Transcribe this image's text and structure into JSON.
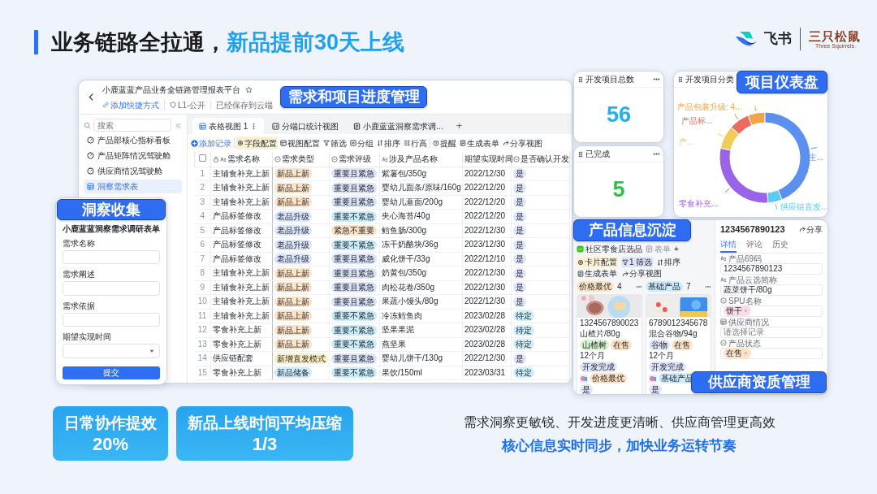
{
  "slide": {
    "title": "业务链路全拉通，",
    "title_highlight": "新品提前30天上线"
  },
  "logo": {
    "product": "飞书",
    "partner": "三只松鼠",
    "partner_en": "Three Squirrels"
  },
  "callouts": [
    "需求和项目进度管理",
    "洞察收集",
    "项目仪表盘",
    "产品信息沉淀",
    "供应商资质管理"
  ],
  "base_window": {
    "title": "小鹿蓝蓝产品业务全链路管理报表平台",
    "shortcut": "添加快捷方式",
    "visibility": "L1-公开",
    "save_status": "已经保存到云端",
    "search": {
      "placeholder": "搜索"
    },
    "sidebar": [
      {
        "label": "产品部核心指标看板",
        "selected": false
      },
      {
        "label": "产品矩阵情况驾驶舱",
        "selected": false
      },
      {
        "label": "供应商情况驾驶舱",
        "selected": false
      },
      {
        "label": "洞察需求表",
        "selected": true
      }
    ],
    "tabs": [
      {
        "label": "表格视图 1",
        "selected": true
      },
      {
        "label": "分端口统计视图",
        "selected": false
      },
      {
        "label": "小鹿蓝蓝洞察需求调...",
        "selected": false
      }
    ],
    "new_tab": "+",
    "add_record": "添加记录",
    "toolbar": [
      {
        "label": "字段配置",
        "active": true
      },
      {
        "label": "视图配置",
        "active": false
      },
      {
        "label": "筛选",
        "active": false
      },
      {
        "label": "分组",
        "active": false
      },
      {
        "label": "排序",
        "active": false
      },
      {
        "label": "行高",
        "active": false
      },
      {
        "label": "提醒",
        "active": false
      },
      {
        "label": "生成表单",
        "active": false
      },
      {
        "label": "分享视图",
        "active": false
      }
    ],
    "table": {
      "columns": [
        {
          "kind": "checkbox",
          "checked": false
        },
        {
          "label": "需求名称",
          "kind": "text",
          "locked": true
        },
        {
          "label": "需求类型",
          "kind": "select",
          "locked": false
        },
        {
          "label": "需求评级",
          "kind": "select",
          "locked": false
        },
        {
          "label": "涉及产品名称",
          "kind": "text",
          "locked": false
        },
        {
          "label": "期望实现时间",
          "kind": "date",
          "locked": false
        },
        {
          "label": "是否确认开发",
          "kind": "select",
          "locked": false
        }
      ],
      "rows": [
        [
          "1",
          "主辅食补充上新",
          {
            "text": "新品上新",
            "color": "#fde3c6"
          },
          {
            "text": "重要且紧急",
            "color": "#dbe3f8"
          },
          "紫薯包/350g",
          "2022/12/30",
          {
            "text": "是",
            "color": "#dfe6fb"
          }
        ],
        [
          "2",
          "主辅食补充上新",
          {
            "text": "新品上新",
            "color": "#fde3c6"
          },
          {
            "text": "重要且紧急",
            "color": "#dbe3f8"
          },
          "婴幼儿面条/原味/160g",
          "2022/12/20",
          {
            "text": "是",
            "color": "#dfe6fb"
          }
        ],
        [
          "3",
          "主辅食补充上新",
          {
            "text": "新品上新",
            "color": "#fde3c6"
          },
          {
            "text": "重要且紧急",
            "color": "#dbe3f8"
          },
          "婴幼儿薏面/200g",
          "2022/12/20",
          {
            "text": "是",
            "color": "#dfe6fb"
          }
        ],
        [
          "4",
          "产品标签修改",
          {
            "text": "老品升级",
            "color": "#dbe5fb"
          },
          {
            "text": "重要不紧急",
            "color": "#c9ecfa"
          },
          "夹心海苔/40g",
          "2022/12/20",
          {
            "text": "是",
            "color": "#dfe6fb"
          }
        ],
        [
          "5",
          "产品标签修改",
          {
            "text": "老品升级",
            "color": "#dbe5fb"
          },
          {
            "text": "紧急不重要",
            "color": "#fde3c6"
          },
          "鳕鱼肠/300g",
          "2022/12/30",
          {
            "text": "是",
            "color": "#dfe6fb"
          }
        ],
        [
          "6",
          "产品标签修改",
          {
            "text": "老品升级",
            "color": "#dbe5fb"
          },
          {
            "text": "重要不紧急",
            "color": "#c9ecfa"
          },
          "冻干奶酪块/36g",
          "2023/12/30",
          {
            "text": "是",
            "color": "#dfe6fb"
          }
        ],
        [
          "7",
          "产品标签修改",
          {
            "text": "老品升级",
            "color": "#dbe5fb"
          },
          {
            "text": "重要且紧急",
            "color": "#dbe3f8"
          },
          "威化饼干/33g",
          "2022/12/10",
          {
            "text": "是",
            "color": "#dfe6fb"
          }
        ],
        [
          "8",
          "主辅食补充上新",
          {
            "text": "新品上新",
            "color": "#fde3c6"
          },
          {
            "text": "重要且紧急",
            "color": "#dbe3f8"
          },
          "奶黄包/350g",
          "2022/12/30",
          {
            "text": "是",
            "color": "#dfe6fb"
          }
        ],
        [
          "9",
          "主辅食补充上新",
          {
            "text": "新品上新",
            "color": "#fde3c6"
          },
          {
            "text": "重要且紧急",
            "color": "#dbe3f8"
          },
          "肉松花卷/350g",
          "2022/12/30",
          {
            "text": "是",
            "color": "#dfe6fb"
          }
        ],
        [
          "10",
          "主辅食补充上新",
          {
            "text": "新品上新",
            "color": "#fde3c6"
          },
          {
            "text": "重要且紧急",
            "color": "#dbe3f8"
          },
          "果蔬小馒头/80g",
          "2022/12/30",
          {
            "text": "是",
            "color": "#dfe6fb"
          }
        ],
        [
          "11",
          "主辅食补充上新",
          {
            "text": "新品上新",
            "color": "#fde3c6"
          },
          {
            "text": "重要不紧急",
            "color": "#c9ecfa"
          },
          "冷冻鳕鱼肉",
          "2023/02/28",
          {
            "text": "待定",
            "color": "#cdeefa"
          }
        ],
        [
          "12",
          "零食补充上新",
          {
            "text": "新品上新",
            "color": "#fde3c6"
          },
          {
            "text": "重要不紧急",
            "color": "#c9ecfa"
          },
          "坚果果泥",
          "2023/02/28",
          {
            "text": "待定",
            "color": "#cdeefa"
          }
        ],
        [
          "13",
          "零食补充上新",
          {
            "text": "新品上新",
            "color": "#fde3c6"
          },
          {
            "text": "重要不紧急",
            "color": "#c9ecfa"
          },
          "燕坚果",
          "2023/02/28",
          {
            "text": "待定",
            "color": "#cdeefa"
          }
        ],
        [
          "14",
          "供应链配套",
          {
            "text": "新增直发模式",
            "color": "#fcefc2"
          },
          {
            "text": "重要且紧急",
            "color": "#dbe3f8"
          },
          "婴幼儿饼干/130g",
          "2022/12/30",
          {
            "text": "是",
            "color": "#dfe6fb"
          }
        ],
        [
          "15",
          "零食补充上新",
          {
            "text": "新品储备",
            "color": "#cdebfa"
          },
          {
            "text": "重要不紧急",
            "color": "#c9ecfa"
          },
          "果饮/150ml",
          "2023/03/31",
          {
            "text": "待定",
            "color": "#cdeefa"
          }
        ]
      ]
    }
  },
  "survey_form": {
    "title": "小鹿蓝蓝洞察需求调研表单",
    "fields": [
      {
        "label": "需求名称",
        "kind": "text"
      },
      {
        "label": "需求阐述",
        "kind": "text"
      },
      {
        "label": "需求依据",
        "kind": "text"
      },
      {
        "label": "期望实现时间",
        "kind": "select"
      }
    ],
    "submit": "提交"
  },
  "stat_cards": [
    {
      "title": "开发项目总数",
      "value": "56",
      "color": "#22b0f0"
    },
    {
      "title": "已完成",
      "value": "5",
      "color": "#2fc24a"
    }
  ],
  "category_chart": {
    "title": "开发项目分类",
    "segments": [
      {
        "label": "产品包装升级: 4...",
        "color": "#f2a447"
      },
      {
        "label": "产品标...",
        "color": "#ec6a60"
      },
      {
        "label": "产...",
        "color": "#f0cc5a"
      },
      {
        "label": "主...",
        "color": "#5b8ff0"
      },
      {
        "label": "零食补充...",
        "color": "#9b63e8"
      },
      {
        "label": "供应链直发...",
        "color": "#5ccbf0"
      }
    ]
  },
  "product_window": {
    "view_tabs": [
      {
        "label": "社区零食店选品",
        "selected": true
      },
      {
        "label": "表单",
        "selected": false
      }
    ],
    "new_tab": "+",
    "toolbar": [
      {
        "label": "卡片配置",
        "active": true,
        "color": "#fbf0d2"
      },
      {
        "label": "1 筛选",
        "active": true,
        "color": "#dfe6fb"
      },
      {
        "label": "排序",
        "active": false
      },
      {
        "label": "生成表单",
        "active": false
      },
      {
        "label": "分享视图",
        "active": false
      }
    ],
    "columns": [
      {
        "label": "价格最优",
        "count": "4",
        "color": "#fde3c6",
        "cards": [
          {
            "code": "1324567890023",
            "name": "山楂片/80g",
            "tags": [
              {
                "text": "山楂树",
                "color": "#d8f3d2"
              },
              {
                "text": "在售",
                "color": "#fde3c6"
              }
            ],
            "shelf_life": "12个月",
            "status": {
              "text": "开发完成",
              "color": "#dfe6fb"
            },
            "group": {
              "text": "价格最优",
              "color": "#fde3c6"
            },
            "flag": {
              "text": "是",
              "color": "#dfe6fb"
            }
          }
        ]
      },
      {
        "label": "基础产品",
        "count": "7",
        "color": "#cdebfa",
        "cards": [
          {
            "code": "6789012345678",
            "name": "混合谷物/94g",
            "tags": [
              {
                "text": "谷物",
                "color": "#dfe6fb"
              },
              {
                "text": "在售",
                "color": "#fde3c6"
              }
            ],
            "shelf_life": "12个月",
            "status": {
              "text": "开发完成",
              "color": "#dfe6fb"
            },
            "group": {
              "text": "基础产品",
              "color": "#cdebfa"
            },
            "flag": {
              "text": "是",
              "color": "#dfe6fb"
            }
          }
        ]
      }
    ],
    "detail": {
      "title": "1234567890123",
      "share": "分享",
      "tabs": [
        {
          "label": "详情",
          "selected": true
        },
        {
          "label": "评论",
          "selected": false
        },
        {
          "label": "历史",
          "selected": false
        }
      ],
      "fields": [
        {
          "label": "产品69码",
          "kind": "text",
          "value": "1234567890123"
        },
        {
          "label": "产品云选简称",
          "kind": "text",
          "value": "蔬菜饼干/80g"
        },
        {
          "label": "SPU名称",
          "kind": "tag",
          "value": "饼干",
          "color": "#fbdbe5"
        },
        {
          "label": "供应商情况",
          "kind": "link",
          "placeholder": "请选择记录"
        },
        {
          "label": "产品状态",
          "kind": "tag",
          "value": "在售",
          "color": "#fde3c6"
        }
      ]
    }
  },
  "summary_boxes": [
    {
      "label": "日常协作提效",
      "value": "20%"
    },
    {
      "label": "新品上线时间平均压缩",
      "value": "1/3"
    }
  ],
  "summary": {
    "line": "需求洞察更敏锐、开发进度更清晰、供应商管理更高效",
    "highlight": "核心信息实时同步，加快业务运转节奏"
  }
}
